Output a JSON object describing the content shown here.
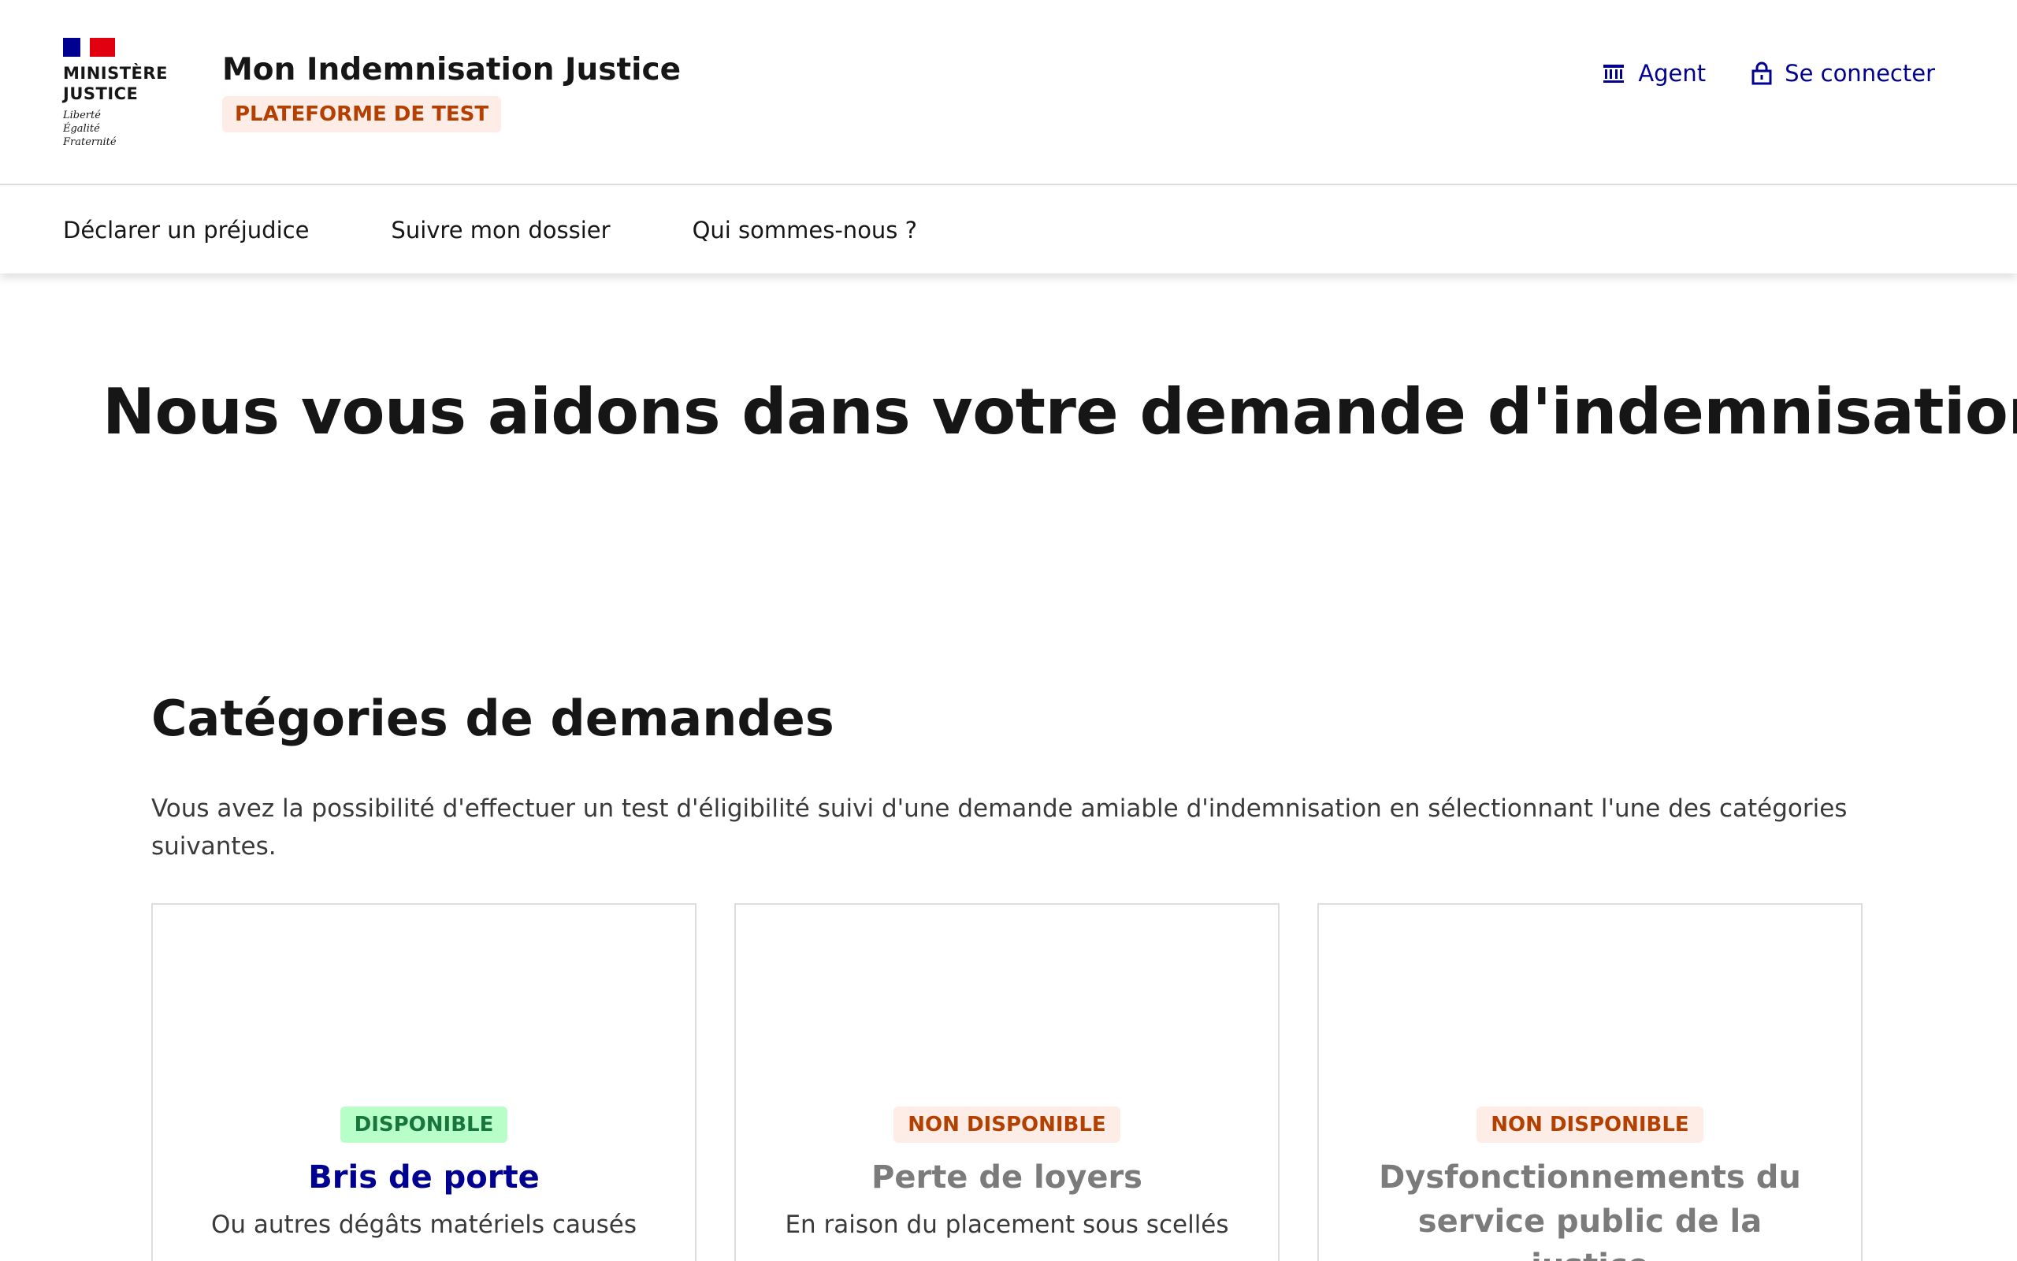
{
  "logo": {
    "ministere_line1": "Ministère",
    "ministere_line2": "Justice",
    "devise": [
      "Liberté",
      "Égalité",
      "Fraternité"
    ],
    "flag_colors": [
      "#000091",
      "#ffffff",
      "#e1000f"
    ]
  },
  "service": {
    "title": "Mon Indemnisation Justice",
    "badge": "PLATEFORME DE TEST"
  },
  "tools": {
    "agent_label": "Agent",
    "agent_icon": "government-building-icon",
    "login_label": "Se connecter",
    "login_icon": "lock-icon"
  },
  "nav": {
    "items": [
      "Déclarer un préjudice",
      "Suivre mon dossier",
      "Qui sommes-nous ?"
    ]
  },
  "hero": {
    "title": "Nous vous aidons dans votre demande d'indemnisation"
  },
  "categories": {
    "title": "Catégories de demandes",
    "description": "Vous avez la possibilité d'effectuer un test d'éligibilité suivi d'une demande amiable d'indemnisation en sélectionnant l'une des catégories suivantes.",
    "cards": [
      {
        "badge": "DISPONIBLE",
        "status": "available",
        "title": "Bris de porte",
        "desc": "Ou autres dégâts matériels causés"
      },
      {
        "badge": "NON DISPONIBLE",
        "status": "unavailable",
        "title": "Perte de loyers",
        "desc": "En raison du placement sous scellés"
      },
      {
        "badge": "NON DISPONIBLE",
        "status": "unavailable",
        "title": "Dysfonctionnements du service public de la justice",
        "desc": ""
      }
    ]
  },
  "colors": {
    "primary_blue": "#000091",
    "available_bg": "#b8fec9",
    "available_text": "#18753c",
    "unavailable_bg": "#feece7",
    "unavailable_text": "#b34000"
  }
}
